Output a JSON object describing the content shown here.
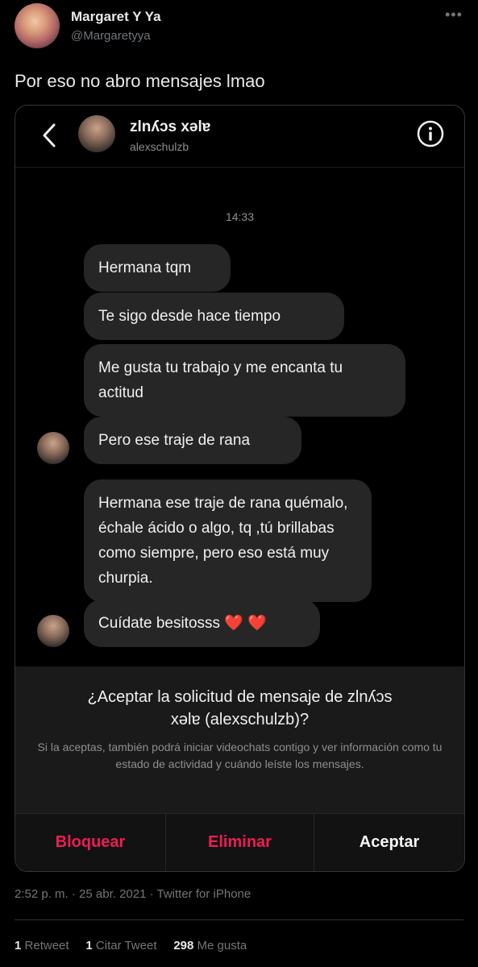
{
  "tweet": {
    "author_name": "Margaret Y Ya",
    "author_handle": "@Margaretyya",
    "more_icon": "more-dots-icon",
    "text": "Por eso no abro mensajes lmao",
    "meta": "2:52 p. m. · 25 abr. 2021 · Twitter for iPhone",
    "stats": {
      "retweets_count": "1",
      "retweets_label": "Retweet",
      "quotes_count": "1",
      "quotes_label": "Citar Tweet",
      "likes_count": "298",
      "likes_label": "Me gusta"
    }
  },
  "dm": {
    "header": {
      "name": "zlnʎɔs xǝlɐ",
      "handle": "alexschulzb",
      "back_icon": "chevron-left-icon",
      "info_icon": "info-circle-icon"
    },
    "timestamp": "14:33",
    "messages": [
      "Hermana tqm",
      "Te sigo desde hace tiempo",
      "Me gusta tu trabajo y me encanta tu actitud",
      "Pero ese traje de rana",
      "Hermana ese traje de rana quémalo, échale ácido o algo, tq ,tú brillabas como siempre, pero eso está muy churpia.",
      "Cuídate besitosss",
      "❤️ ❤️"
    ],
    "request": {
      "title_line1": "¿Aceptar la solicitud de mensaje de zlnʎɔs",
      "title_line2": "xǝlɐ (alexschulzb)?",
      "body": "Si la aceptas, también podrá iniciar videochats contigo y ver información como tu estado de actividad y cuándo leíste los mensajes."
    },
    "actions": {
      "block": "Bloquear",
      "delete": "Eliminar",
      "accept": "Aceptar"
    },
    "colors": {
      "danger": "#ed1d55",
      "accept": "#f5f5f5",
      "bubble": "#262626"
    }
  }
}
